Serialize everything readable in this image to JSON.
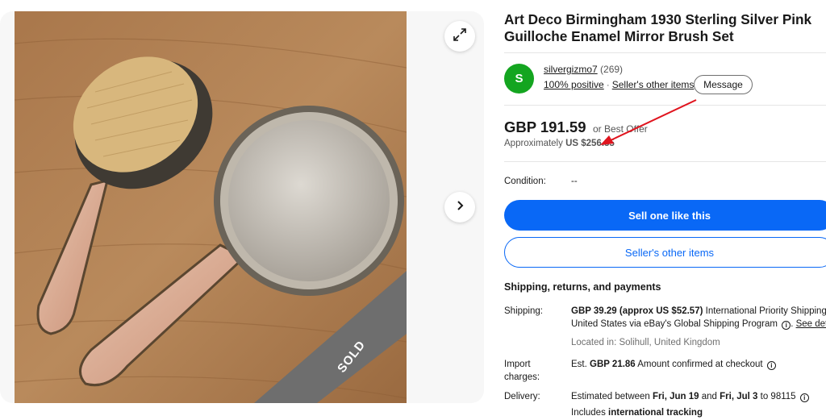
{
  "listing": {
    "title_line1": "Art Deco Birmingham 1930 Sterling Silver Pink",
    "title_line2": "Guilloche Enamel Mirror Brush Set",
    "sold_label": "SOLD"
  },
  "seller": {
    "avatar_letter": "S",
    "name": "silvergizmo7",
    "feedback_count": "(269)",
    "positive": "100% positive",
    "other_items_link": "Seller's other items",
    "message_button": "Message"
  },
  "price": {
    "amount": "GBP 191.59",
    "best_offer": "or Best Offer",
    "approx_prefix": "Approximately",
    "approx_value": "US $256.35"
  },
  "condition": {
    "label": "Condition:",
    "value": "--"
  },
  "buttons": {
    "sell_one": "Sell one like this",
    "seller_other": "Seller's other items"
  },
  "shipping_section": {
    "heading": "Shipping, returns, and payments",
    "shipping_label": "Shipping:",
    "shipping_cost": "GBP 39.29 (approx US $52.57)",
    "shipping_method": "International Priority Shipping to",
    "shipping_line2": "United States via eBay's Global Shipping Program",
    "see_details": "See details",
    "located": "Located in: Solihull, United Kingdom",
    "import_label1": "Import",
    "import_label2": "charges:",
    "import_prefix": "Est.",
    "import_value": "GBP 21.86",
    "import_note": "Amount confirmed at checkout",
    "delivery_label": "Delivery:",
    "delivery_prefix": "Estimated between",
    "delivery_from": "Fri, Jun 19",
    "delivery_and": "and",
    "delivery_to": "Fri, Jul 3",
    "delivery_zip": "to 98115",
    "tracking_prefix": "Includes",
    "tracking_value": "international tracking"
  },
  "icons": {
    "expand": "expand-icon",
    "next": "chevron-right-icon",
    "info": "info-icon",
    "annotation": "red-arrow"
  },
  "colors": {
    "primary_blue": "#0968f6",
    "avatar_green": "#14a520",
    "annotation_red": "#e0141e"
  }
}
